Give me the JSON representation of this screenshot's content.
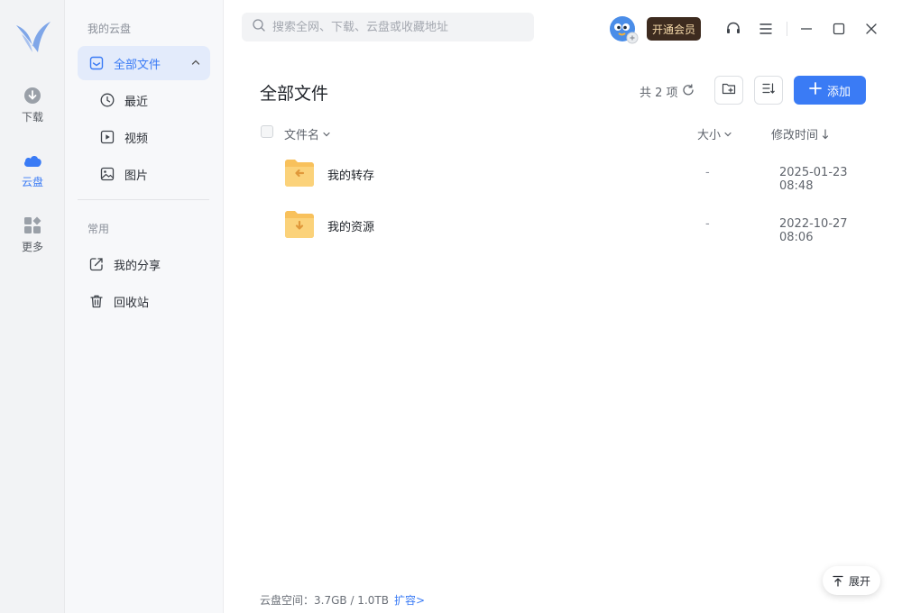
{
  "rail": {
    "items": [
      {
        "label": "下载",
        "icon": "download-icon"
      },
      {
        "label": "云盘",
        "icon": "cloud-icon"
      },
      {
        "label": "更多",
        "icon": "apps-grid-icon"
      }
    ]
  },
  "sidebar": {
    "section_mine": "我的云盘",
    "all_files": "全部文件",
    "sub_items": [
      {
        "label": "最近",
        "icon": "clock-icon"
      },
      {
        "label": "视频",
        "icon": "video-icon"
      },
      {
        "label": "图片",
        "icon": "image-icon"
      }
    ],
    "section_common": "常用",
    "common_items": [
      {
        "label": "我的分享",
        "icon": "share-icon"
      },
      {
        "label": "回收站",
        "icon": "trash-icon"
      }
    ]
  },
  "search": {
    "placeholder": "搜索全网、下载、云盘或收藏地址"
  },
  "header": {
    "vip_label": "开通会员"
  },
  "main": {
    "title": "全部文件",
    "count": "共 2 项",
    "add_label": "添加",
    "columns": {
      "name": "文件名",
      "size": "大小",
      "modified": "修改时间"
    },
    "files": [
      {
        "name": "我的转存",
        "size": "-",
        "modified": "2025-01-23 08:48",
        "icon": "folder-transfer-icon"
      },
      {
        "name": "我的资源",
        "size": "-",
        "modified": "2022-10-27 08:06",
        "icon": "folder-download-icon"
      }
    ]
  },
  "footer": {
    "storage_label": "云盘空间：",
    "storage_value": "3.7GB / 1.0TB",
    "expand_label": "扩容>"
  },
  "float_button": {
    "label": "展开"
  },
  "colors": {
    "accent": "#3a7bf5",
    "vip_bg": "#3d2b1f",
    "vip_text": "#f4d8a8",
    "folder": "#f8c15c"
  }
}
